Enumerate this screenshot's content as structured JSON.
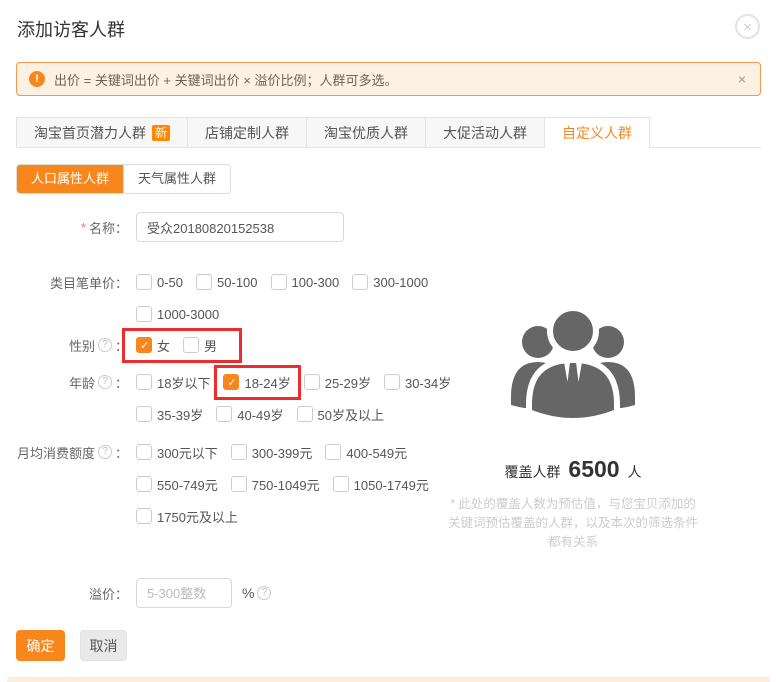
{
  "ui": {
    "colon": "：",
    "close_x": "×",
    "help_mark": "?",
    "alert_mark": "!"
  },
  "dialog": {
    "title": "添加访客人群"
  },
  "notice": {
    "text": "出价 = 关键词出价 + 关键词出价 × 溢价比例；人群可多选。"
  },
  "tabs": [
    {
      "label": "淘宝首页潜力人群",
      "badge": "新",
      "active": false
    },
    {
      "label": "店铺定制人群",
      "active": false
    },
    {
      "label": "淘宝优质人群",
      "active": false
    },
    {
      "label": "大促活动人群",
      "active": false
    },
    {
      "label": "自定义人群",
      "active": true
    }
  ],
  "subtabs": [
    {
      "label": "人口属性人群",
      "active": true
    },
    {
      "label": "天气属性人群",
      "active": false
    }
  ],
  "form": {
    "name": {
      "required": "*",
      "label": "名称：",
      "value": "受众20180820152538"
    },
    "category_price": {
      "label": "类目笔单价：",
      "rows": [
        [
          {
            "label": "0-50",
            "checked": false
          },
          {
            "label": "50-100",
            "checked": false
          },
          {
            "label": "100-300",
            "checked": false
          },
          {
            "label": "300-1000",
            "checked": false
          }
        ],
        [
          {
            "label": "1000-3000",
            "checked": false
          }
        ]
      ]
    },
    "gender": {
      "label": "性别",
      "options": [
        {
          "label": "女",
          "checked": true
        },
        {
          "label": "男",
          "checked": false
        }
      ],
      "highlighted": true
    },
    "age": {
      "label": "年龄",
      "rows": [
        [
          {
            "label": "18岁以下",
            "checked": false
          },
          {
            "label": "18-24岁",
            "checked": true,
            "highlighted": true
          },
          {
            "label": "25-29岁",
            "checked": false
          },
          {
            "label": "30-34岁",
            "checked": false
          }
        ],
        [
          {
            "label": "35-39岁",
            "checked": false
          },
          {
            "label": "40-49岁",
            "checked": false
          },
          {
            "label": "50岁及以上",
            "checked": false
          }
        ]
      ]
    },
    "monthly_spend": {
      "label": "月均消费额度",
      "rows": [
        [
          {
            "label": "300元以下",
            "checked": false
          },
          {
            "label": "300-399元",
            "checked": false
          },
          {
            "label": "400-549元",
            "checked": false
          }
        ],
        [
          {
            "label": "550-749元",
            "checked": false
          },
          {
            "label": "750-1049元",
            "checked": false
          },
          {
            "label": "1050-1749元",
            "checked": false
          }
        ],
        [
          {
            "label": "1750元及以上",
            "checked": false
          }
        ]
      ]
    },
    "premium": {
      "label": "溢价：",
      "placeholder": "5-300整数",
      "unit": "%"
    }
  },
  "coverage": {
    "label": "覆盖人群",
    "value": "6500",
    "unit": "人",
    "note_lines": [
      "* 此处的覆盖人数为预估值，与您宝贝添加的",
      "关键词预估覆盖的人群，以及本次的筛选条件",
      "都有关系"
    ]
  },
  "footer": {
    "confirm": "确定",
    "cancel": "取消"
  },
  "colors": {
    "accent": "#f7861d",
    "badge": "#ff8800",
    "highlight_box": "#ed2d2d",
    "icon_gray": "#666666",
    "notice_bg": "#fdf1e3",
    "notice_border": "#f8964b"
  }
}
